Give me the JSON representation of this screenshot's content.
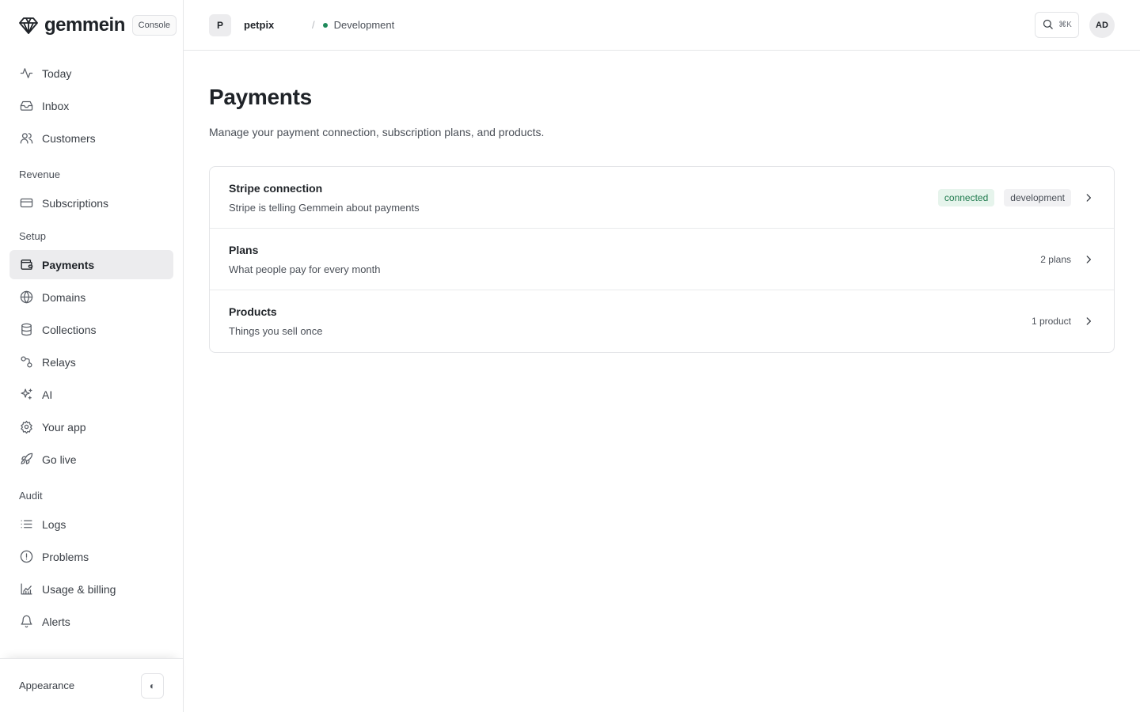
{
  "brand": {
    "name": "gemmein",
    "console_label": "Console",
    "logo_icon": "diamond-logo-icon"
  },
  "sidebar": {
    "primary": [
      {
        "label": "Today",
        "icon": "activity-icon"
      },
      {
        "label": "Inbox",
        "icon": "inbox-icon"
      },
      {
        "label": "Customers",
        "icon": "users-icon"
      }
    ],
    "sections": [
      {
        "title": "Revenue",
        "items": [
          {
            "label": "Subscriptions",
            "icon": "credit-card-icon"
          }
        ]
      },
      {
        "title": "Setup",
        "items": [
          {
            "label": "Payments",
            "icon": "wallet-icon",
            "active": true
          },
          {
            "label": "Domains",
            "icon": "globe-icon"
          },
          {
            "label": "Collections",
            "icon": "database-icon"
          },
          {
            "label": "Relays",
            "icon": "route-icon"
          },
          {
            "label": "AI",
            "icon": "sparkles-icon"
          },
          {
            "label": "Your app",
            "icon": "settings-icon"
          },
          {
            "label": "Go live",
            "icon": "rocket-icon"
          }
        ]
      },
      {
        "title": "Audit",
        "items": [
          {
            "label": "Logs",
            "icon": "list-icon"
          },
          {
            "label": "Problems",
            "icon": "alert-circle-icon"
          },
          {
            "label": "Usage & billing",
            "icon": "chart-icon"
          },
          {
            "label": "Alerts",
            "icon": "bell-icon"
          }
        ]
      }
    ],
    "footer": {
      "appearance_label": "Appearance",
      "toggle_glyph": "◐"
    }
  },
  "topbar": {
    "project_initial": "P",
    "project_name": "petpix",
    "separator": "/",
    "environment": "Development",
    "search_shortcut": "⌘K",
    "user_initials": "AD"
  },
  "page": {
    "title": "Payments",
    "description": "Manage your payment connection, subscription plans, and products."
  },
  "settings_rows": {
    "stripe": {
      "title": "Stripe connection",
      "subtitle": "Stripe is telling Gemmein about payments",
      "status": "connected",
      "mode": "development"
    },
    "plans": {
      "title": "Plans",
      "subtitle": "What people pay for every month",
      "count": "2 plans"
    },
    "products": {
      "title": "Products",
      "subtitle": "Things you sell once",
      "count": "1 product"
    }
  },
  "colors": {
    "accent_green": "#1f8a5b",
    "active_bg": "#ececee",
    "border": "#e3e4e7"
  }
}
